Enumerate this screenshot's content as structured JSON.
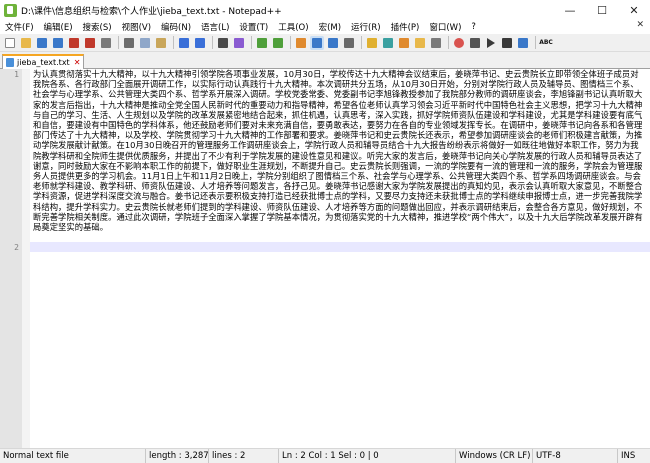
{
  "window": {
    "title": "D:\\课件\\信息组织与检索\\个人作业\\jieba_text.txt - Notepad++",
    "minimize_glyph": "—",
    "maximize_glyph": "☐",
    "close_glyph": "✕"
  },
  "menu": {
    "items": [
      "文件(F)",
      "编辑(E)",
      "搜索(S)",
      "视图(V)",
      "编码(N)",
      "语言(L)",
      "设置(T)",
      "工具(O)",
      "宏(M)",
      "运行(R)",
      "插件(P)",
      "窗口(W)",
      "?"
    ],
    "close_glyph": "✕"
  },
  "toolbar": {
    "spellcheck_label": "ABC",
    "colors": {
      "new": "#ffffff",
      "open": "#e8b84a",
      "save": "#3a78c9",
      "saveall": "#3a78c9",
      "close": "#c0392b",
      "closeall": "#c0392b",
      "print": "#7a7a7a",
      "cut": "#6b6b6b",
      "copy": "#8fa7c9",
      "paste": "#c9a65a",
      "undo": "#3a6fd8",
      "redo": "#3a6fd8",
      "find": "#4a4a4a",
      "replace": "#8a5bd1",
      "zoomin": "#4f9f3a",
      "zoomout": "#4f9f3a",
      "sync": "#e08a2e",
      "wrap": "#3a78c9",
      "allchars": "#3a78c9",
      "indent": "#6a6a6a",
      "lang": "#e0b030",
      "map": "#3aa0a0",
      "funclist": "#e08a2e",
      "folder": "#e8b84a",
      "monitor": "#7a7a7a",
      "record": "#d9534f",
      "stop": "#555555",
      "play": "#3a3a3a",
      "playmulti": "#3a3a3a",
      "savemacro": "#3a78c9"
    }
  },
  "tab": {
    "label": "jieba_text.txt",
    "close_glyph": "✕"
  },
  "editor": {
    "line_numbers": [
      "1",
      "2"
    ],
    "line1": "为认真贯彻落实十九大精神，以十九大精神引领学院各项事业发展，10月30日，学校传达十九大精神会议结束后，姜晓萍书记、史云贵院长立即带领全体班子成员对我院各系、各行政部门全面展开调研工作，以实际行动认真践行十九大精神。本次调研共分五场，从10月30日开始，分别对学院行政人员及辅导员、图情档三个系、社会学与心理学系、公共管理大类四个系、哲学系开展深入调研。学校党委常委、党委副书记李旭锋教授参加了我院部分教师的调研座谈会，李旭锋副书记认真听取大家的发言后指出，十九大精神是推动全党全国人民新时代的重要动力和指导精神，希望各位老师认真学习领会习近平新时代中国特色社会主义思想，把学习十九大精神与自己的学习、生活、人生规划以及学院的改革发展紧密地结合起来，抓住机遇，认真思考，深入实践，抓好学院师资队伍建设和学科建设，尤其是学科建设要有底气和自信，要建设有中国特色的学科体系，他还鼓励老师们要对未来充满自信，要勇敢表达，要努力在各自的专业领域发挥专长。在调研中，姜晓萍书记向各系和各管理部门传达了十九大精神，以及学校、学院贯彻学习十九大精神的工作部署和要求。姜晓萍书记和史云贵院长还表示，希望参加调研座谈会的老师们积极建言献策，为推动学院发展献计献策。在10月30日晚召开的管理服务工作调研座谈会上，学院行政人员和辅导员结合十九大报告纷纷表示将做好一如既往地做好本职工作，努力为我院教学科研和全院师生提供优质服务，并提出了不少有利于学院发展的建设性意见和建议。听完大家的发言后，姜晓萍书记向关心学院发展的行政人员和辅导员表达了谢意，同时鼓励大家在不影响本职工作的前提下，做好职业生涯规划，不断提升自己。史云贵院长则强调，一流的学院要有一流的管理和一流的服务，学院会为管理服务人员提供更多的学习机会。11月1日上午和11月2日晚上，学院分别组织了图情档三个系、社会学与心理学系、公共管理大类四个系、哲学系四场调研座谈会。与会老师就学科建设、教学科研、师资队伍建设、人才培养等问题发言，各抒己见。姜晓萍书记感谢大家为学院发展提出的真知灼见，表示会认真听取大家意见，不断整合学科资源，促进学科深度交流与融合。姜书记还表示要积极支持打造已经获批博士点的学科，又要尽力支持还未获批博士点的学科继续申报博士点，进一步完善我院学科结构，提升学科实力。史云贵院长就老师们提到的学科建设、师资队伍建设、人才培养等方面的问题做出回应，并表示调研结束后，会整合各方意见，做好规划，不断完善学院相关制度。通过此次调研，学院班子全面深入掌握了学院基本情况，为贯彻落实党的十九大精神，推进学校“两个伟大”，以及十九大后学院改革发展开辟有局奠定坚实的基础。"
  },
  "status": {
    "file_type": "Normal text file",
    "length": "length : 3,287",
    "lines": "lines : 2",
    "position": "Ln : 2    Col : 1    Sel : 0 | 0",
    "eol": "Windows (CR LF)",
    "encoding": "UTF-8",
    "mode": "INS"
  }
}
